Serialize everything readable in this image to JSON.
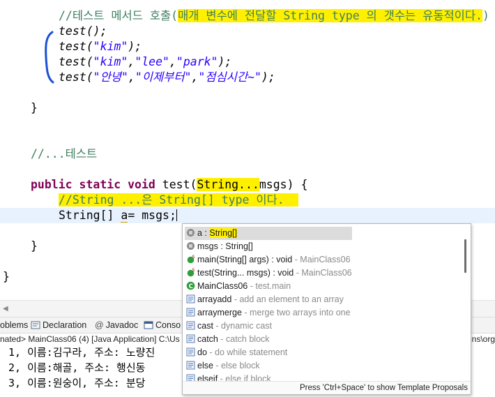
{
  "editor": {
    "comment1_prefix": "//테스트 메서드 호출(",
    "comment1_highlight": "매개 변수에 전달할 String type 의 갯수는 유동적이다.",
    "comment1_suffix": ")",
    "call1": "test();",
    "call2_fn": "test(",
    "call2_arg1": "\"kim\"",
    "call2_end": ");",
    "call3_fn": "test(",
    "call3_arg1": "\"kim\"",
    "call3_arg2": "\"lee\"",
    "call3_arg3": "\"park\"",
    "call3_end": ");",
    "call4_fn": "test(",
    "call4_arg1": "\"안녕\"",
    "call4_arg2": "\"이제부터\"",
    "call4_arg3": "\"점심시간~\"",
    "call4_end": ");",
    "comma": ",",
    "close_brace1": "}",
    "comment2": "//...테스트",
    "kw_public": "public",
    "kw_static": "static",
    "kw_void": "void",
    "method_name": "test(",
    "param_highlight": "String...",
    "param_name": "msgs) {",
    "comment3": "//String ...은 String[] type 이다.",
    "decl_type": "String[] ",
    "decl_var": "a",
    "decl_rest": "= msgs;",
    "close_brace2": "}",
    "close_brace3": "}"
  },
  "tabs": [
    {
      "label": "oblems",
      "icon": "problems-icon"
    },
    {
      "label": "Declaration",
      "icon": "declaration-icon"
    },
    {
      "label": "Javadoc",
      "icon": "javadoc-icon"
    },
    {
      "label": "Conso",
      "icon": "console-icon"
    }
  ],
  "console": {
    "header_left": "nated> MainClass06 (4) [Java Application] C:\\Us",
    "header_right": "ns\\org",
    "lines": [
      "1, 이름:김구라, 주소: 노량진",
      "2, 이름:해골, 주소: 행신동",
      "3, 이름:원숭이, 주소: 분당"
    ]
  },
  "assist": {
    "items": [
      {
        "main": "a : ",
        "hl": "String[]",
        "sec": "",
        "icon": "local-variable-icon"
      },
      {
        "main": "msgs : String[]",
        "hl": "",
        "sec": "",
        "icon": "local-variable-icon"
      },
      {
        "main": "main(String[] args) : void",
        "hl": "",
        "sec": " - MainClass06",
        "icon": "static-method-icon"
      },
      {
        "main": "test(String... msgs) : void",
        "hl": "",
        "sec": " - MainClass06",
        "icon": "static-method-icon"
      },
      {
        "main": "MainClass06",
        "hl": "",
        "sec": " - test.main",
        "icon": "class-icon"
      },
      {
        "main": "arrayadd",
        "hl": "",
        "sec": " - add an element to an array",
        "icon": "template-icon"
      },
      {
        "main": "arraymerge",
        "hl": "",
        "sec": " - merge two arrays into one",
        "icon": "template-icon"
      },
      {
        "main": "cast",
        "hl": "",
        "sec": " - dynamic cast",
        "icon": "template-icon"
      },
      {
        "main": "catch",
        "hl": "",
        "sec": " - catch block",
        "icon": "template-icon"
      },
      {
        "main": "do",
        "hl": "",
        "sec": " - do while statement",
        "icon": "template-icon"
      },
      {
        "main": "else",
        "hl": "",
        "sec": " - else block",
        "icon": "template-icon"
      },
      {
        "main": "elseif",
        "hl": "",
        "sec": " - else if block",
        "icon": "template-icon"
      }
    ],
    "footer": "Press 'Ctrl+Space' to show Template Proposals"
  },
  "colors": {
    "comment": "#3f7f5f",
    "keyword": "#7f0055",
    "string": "#2a00ff",
    "highlight": "#fff000",
    "pen": "#1a4fd6"
  }
}
